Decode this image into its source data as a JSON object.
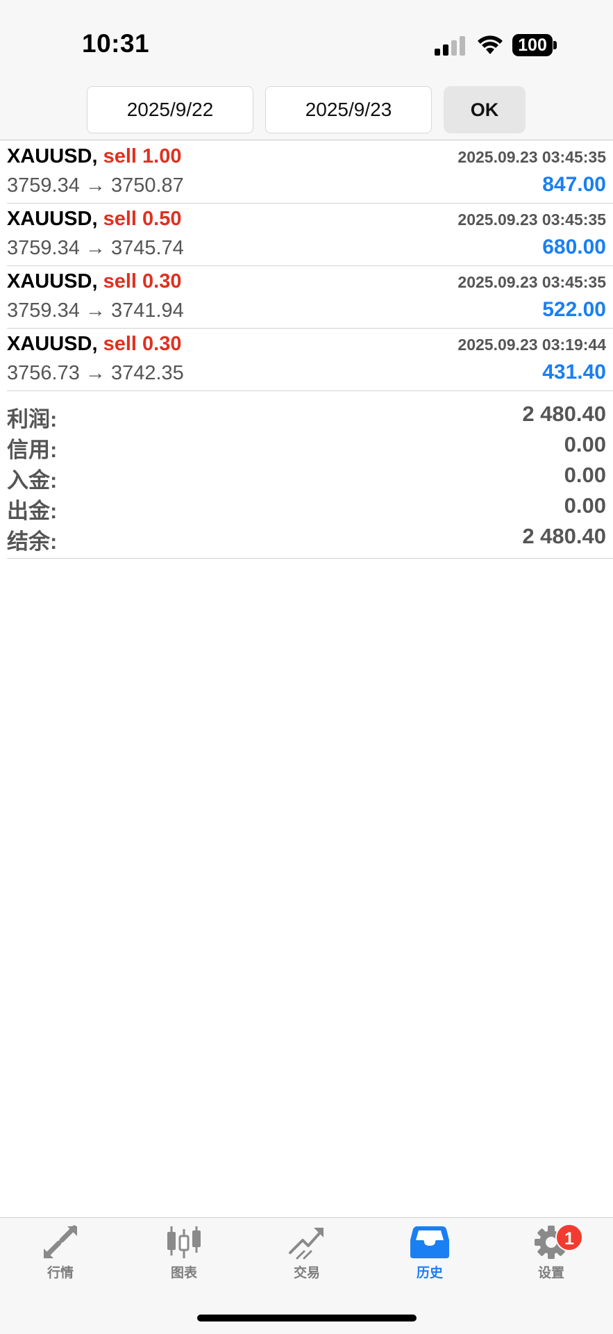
{
  "status": {
    "time": "10:31",
    "battery": "100"
  },
  "date_range": {
    "from": "2025/9/22",
    "to": "2025/9/23",
    "ok_label": "OK"
  },
  "trades": [
    {
      "symbol": "XAUUSD,",
      "side": "sell 1.00",
      "datetime": "2025.09.23 03:45:35",
      "prices": "3759.34 → 3750.87",
      "profit": "847.00"
    },
    {
      "symbol": "XAUUSD,",
      "side": "sell 0.50",
      "datetime": "2025.09.23 03:45:35",
      "prices": "3759.34 → 3745.74",
      "profit": "680.00"
    },
    {
      "symbol": "XAUUSD,",
      "side": "sell 0.30",
      "datetime": "2025.09.23 03:45:35",
      "prices": "3759.34 → 3741.94",
      "profit": "522.00"
    },
    {
      "symbol": "XAUUSD,",
      "side": "sell 0.30",
      "datetime": "2025.09.23 03:19:44",
      "prices": "3756.73 → 3742.35",
      "profit": "431.40"
    }
  ],
  "summary": [
    {
      "label": "利润:",
      "value": "2 480.40"
    },
    {
      "label": "信用:",
      "value": "0.00"
    },
    {
      "label": "入金:",
      "value": "0.00"
    },
    {
      "label": "出金:",
      "value": "0.00"
    },
    {
      "label": "结余:",
      "value": "2 480.40"
    }
  ],
  "tabs": [
    {
      "label": "行情",
      "icon": "quotes-arrows-icon"
    },
    {
      "label": "图表",
      "icon": "candlestick-chart-icon"
    },
    {
      "label": "交易",
      "icon": "trade-trend-icon"
    },
    {
      "label": "历史",
      "icon": "history-inbox-icon",
      "active": true
    },
    {
      "label": "设置",
      "icon": "settings-gear-icon",
      "badge": "1"
    }
  ],
  "colors": {
    "sell": "#e0301e",
    "profit": "#1a7ff2",
    "active_tab": "#1a7ff2",
    "badge": "#f23b30"
  }
}
